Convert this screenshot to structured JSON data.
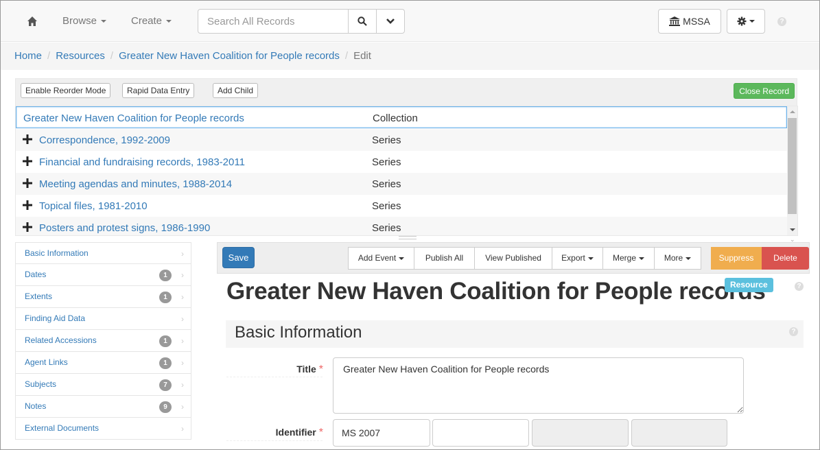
{
  "navbar": {
    "browse_label": "Browse",
    "create_label": "Create",
    "search_placeholder": "Search All Records",
    "repo_label": "MSSA",
    "help_glyph": "?"
  },
  "breadcrumb": {
    "items": [
      "Home",
      "Resources",
      "Greater New Haven Coalition for People records"
    ],
    "current": "Edit"
  },
  "tree_toolbar": {
    "reorder_label": "Enable Reorder Mode",
    "rde_label": "Rapid Data Entry",
    "add_child_label": "Add Child",
    "close_label": "Close Record"
  },
  "tree": {
    "rows": [
      {
        "title": "Greater New Haven Coalition for People records",
        "level": "Collection"
      },
      {
        "title": "Correspondence, 1992-2009",
        "level": "Series"
      },
      {
        "title": "Financial and fundraising records, 1983-2011",
        "level": "Series"
      },
      {
        "title": "Meeting agendas and minutes, 1988-2014",
        "level": "Series"
      },
      {
        "title": "Topical files, 1981-2010",
        "level": "Series"
      },
      {
        "title": "Posters and protest signs, 1986-1990",
        "level": "Series"
      }
    ]
  },
  "sidenav": {
    "items": [
      {
        "label": "Basic Information",
        "count": ""
      },
      {
        "label": "Dates",
        "count": "1"
      },
      {
        "label": "Extents",
        "count": "1"
      },
      {
        "label": "Finding Aid Data",
        "count": ""
      },
      {
        "label": "Related Accessions",
        "count": "1"
      },
      {
        "label": "Agent Links",
        "count": "1"
      },
      {
        "label": "Subjects",
        "count": "7"
      },
      {
        "label": "Notes",
        "count": "9"
      },
      {
        "label": "External Documents",
        "count": ""
      }
    ]
  },
  "record_toolbar": {
    "save_label": "Save",
    "add_event_label": "Add Event",
    "publish_all_label": "Publish All",
    "view_published_label": "View Published",
    "export_label": "Export",
    "merge_label": "Merge",
    "more_label": "More",
    "suppress_label": "Suppress",
    "delete_label": "Delete"
  },
  "record": {
    "title": "Greater New Haven Coalition for People records",
    "type_badge": "Resource",
    "section_heading": "Basic Information",
    "title_label": "Title",
    "title_value": "Greater New Haven Coalition for People records",
    "identifier_label": "Identifier",
    "identifier_values": [
      "MS 2007",
      "",
      "",
      ""
    ],
    "required_mark": "*"
  },
  "colors": {
    "link": "#337ab7",
    "success": "#5cb85c",
    "warning": "#f0ad4e",
    "danger": "#d9534f",
    "info": "#5bc0de",
    "primary": "#337ab7"
  }
}
